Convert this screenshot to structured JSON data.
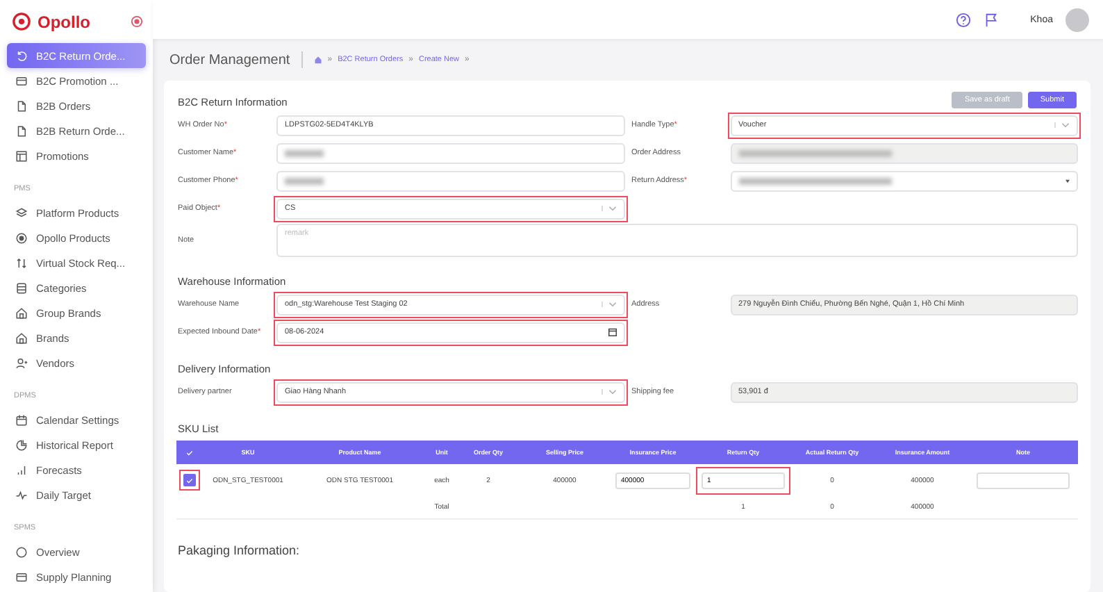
{
  "sidebar": {
    "brand": "Opollo",
    "groups": [
      {
        "items": [
          {
            "label": "B2C Return Orde...",
            "selected": true
          },
          {
            "label": "B2C Promotion ...",
            "selected": false
          },
          {
            "label": "B2B Orders",
            "selected": false
          },
          {
            "label": "B2B Return Orde...",
            "selected": false
          },
          {
            "label": "Promotions",
            "selected": false
          }
        ]
      },
      {
        "heading": "PMS",
        "items": [
          {
            "label": "Platform Products",
            "selected": false
          },
          {
            "label": "Opollo Products",
            "selected": false
          },
          {
            "label": "Virtual Stock Req...",
            "selected": false
          },
          {
            "label": "Categories",
            "selected": false
          },
          {
            "label": "Group Brands",
            "selected": false
          },
          {
            "label": "Brands",
            "selected": false
          },
          {
            "label": "Vendors",
            "selected": false
          }
        ]
      },
      {
        "heading": "DPMS",
        "items": [
          {
            "label": "Calendar Settings",
            "selected": false
          },
          {
            "label": "Historical Report",
            "selected": false
          },
          {
            "label": "Forecasts",
            "selected": false
          },
          {
            "label": "Daily Target",
            "selected": false
          }
        ]
      },
      {
        "heading": "SPMS",
        "items": [
          {
            "label": "Overview",
            "selected": false
          },
          {
            "label": "Supply Planning",
            "selected": false
          }
        ]
      }
    ]
  },
  "topbar": {
    "user": "Khoa"
  },
  "page": {
    "title": "Order Management",
    "breadcrumbs": [
      {
        "kind": "separator",
        "text": "»"
      },
      {
        "kind": "link",
        "text": "B2C Return Orders"
      },
      {
        "kind": "separator",
        "text": "»"
      },
      {
        "kind": "link",
        "text": "Create New"
      },
      {
        "kind": "separator",
        "text": "»"
      }
    ]
  },
  "buttons": [
    {
      "label": "Save as draft",
      "kind": "secondary"
    },
    {
      "label": "Submit",
      "kind": "primary"
    }
  ],
  "sections": [
    {
      "title": "B2C Return Information",
      "rows": [
        {
          "left": {
            "label": "WH Order No",
            "required_mark": "*",
            "kind": "text",
            "value": "LDPSTG02-5ED4T4KLYB",
            "highlighted": false
          },
          "right": {
            "label": "Handle Type",
            "required_mark": "*",
            "kind": "select",
            "value": "Voucher",
            "highlighted": true
          }
        },
        {
          "left": {
            "label": "Customer Name",
            "required_mark": "*",
            "kind": "blurred",
            "highlighted": false
          },
          "right": {
            "label": "Order Address",
            "kind": "blurred-readonly",
            "highlighted": false
          }
        },
        {
          "left": {
            "label": "Customer Phone",
            "required_mark": "*",
            "kind": "blurred",
            "highlighted": false
          },
          "right": {
            "label": "Return Address",
            "required_mark": "*",
            "kind": "blurred-select",
            "highlighted": false
          }
        },
        {
          "left": {
            "label": "Paid Object",
            "required_mark": "*",
            "kind": "select",
            "value": "CS",
            "highlighted": true
          }
        },
        {
          "left": {
            "label": "Note",
            "kind": "textarea",
            "placeholder": "remark",
            "highlighted": false
          }
        }
      ]
    },
    {
      "title": "Warehouse Information",
      "rows": [
        {
          "left": {
            "label": "Warehouse Name",
            "kind": "select",
            "value": "odn_stg:Warehouse Test Staging 02",
            "highlighted": true
          },
          "right": {
            "label": "Address",
            "kind": "readonly",
            "value": "279 Nguyễn Đình Chiểu, Phường Bến Nghé, Quận 1, Hồ Chí Minh",
            "highlighted": false
          }
        },
        {
          "left": {
            "label": "Expected Inbound Date",
            "required_mark": "*",
            "kind": "date",
            "value": "08-06-2024",
            "highlighted": true
          }
        }
      ]
    },
    {
      "title": "Delivery Information",
      "rows": [
        {
          "left": {
            "label": "Delivery partner",
            "kind": "select",
            "value": "Giao Hàng Nhanh",
            "highlighted": true
          },
          "right": {
            "label": "Shipping fee",
            "kind": "readonly",
            "value": "53,901 đ",
            "highlighted": false
          }
        }
      ]
    }
  ],
  "sku_list": {
    "title": "SKU List",
    "columns": [
      "SKU",
      "Product Name",
      "Unit",
      "Order Qty",
      "Selling Price",
      "Insurance Price",
      "Return Qty",
      "Actual Return Qty",
      "Insurance Amount",
      "Note"
    ],
    "rows": [
      {
        "checked": true,
        "highlighted": true,
        "cells": [
          {
            "kind": "text",
            "value": "ODN_STG_TEST0001"
          },
          {
            "kind": "text",
            "value": "ODN STG TEST0001"
          },
          {
            "kind": "text",
            "value": "each"
          },
          {
            "kind": "text",
            "value": "2"
          },
          {
            "kind": "text",
            "value": "400000"
          },
          {
            "kind": "input",
            "value": "400000",
            "highlighted": false
          },
          {
            "kind": "input",
            "value": "1",
            "highlighted": true
          },
          {
            "kind": "text",
            "value": "0"
          },
          {
            "kind": "text",
            "value": "400000"
          },
          {
            "kind": "input",
            "highlighted": false
          }
        ]
      }
    ],
    "total": {
      "label": "Total",
      "return_qty": "1",
      "actual_return_qty": "0",
      "insurance_amount": "400000"
    }
  },
  "next_section": "Pakaging Information:"
}
